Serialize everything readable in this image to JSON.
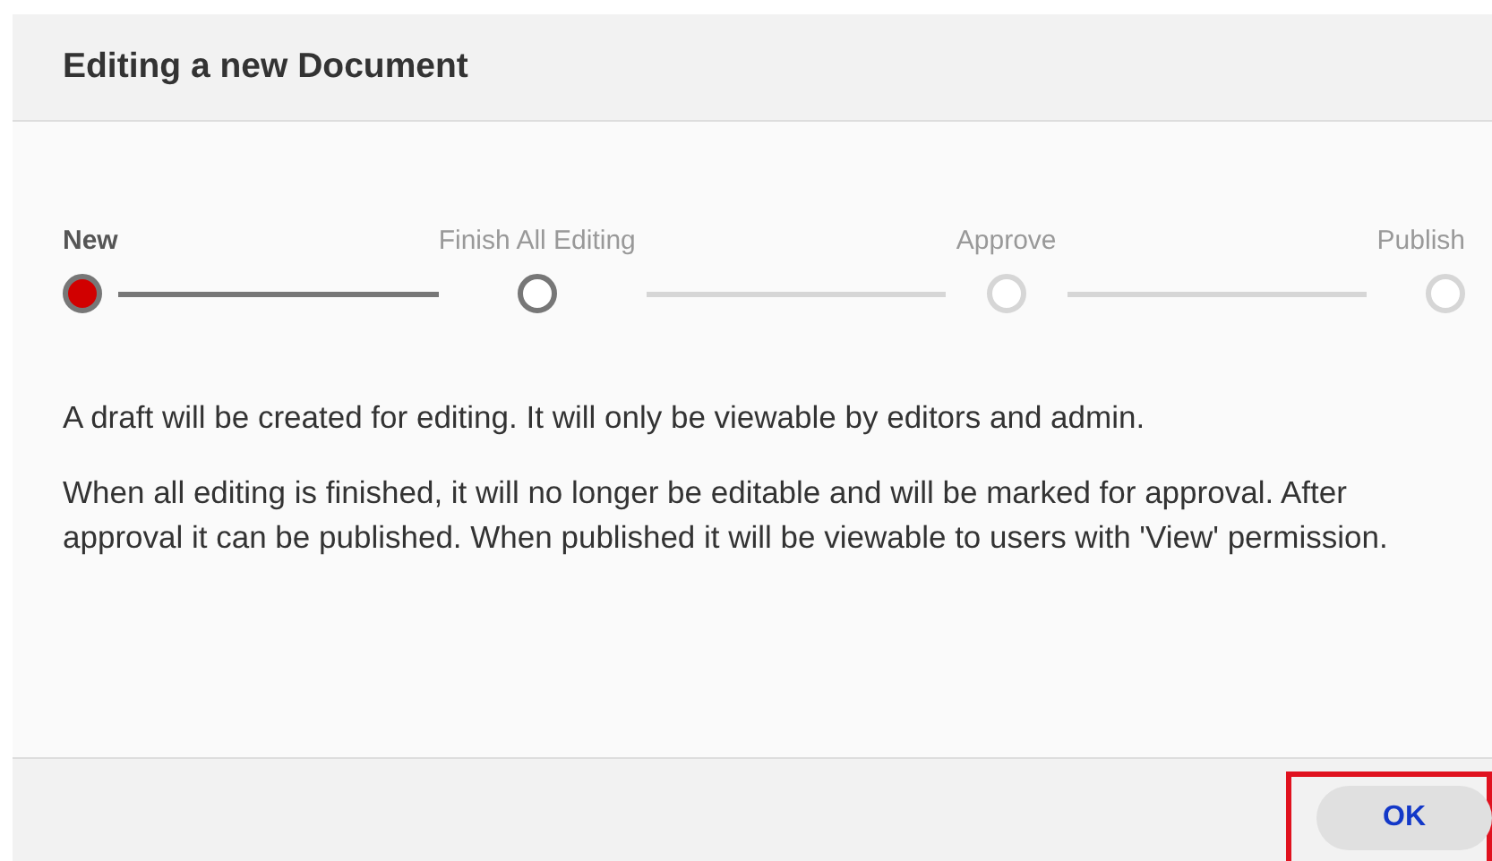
{
  "dialog": {
    "title": "Editing a new Document",
    "steps": [
      {
        "label": "New",
        "current": true,
        "reached": true
      },
      {
        "label": "Finish All Editing",
        "current": false,
        "reached": true
      },
      {
        "label": "Approve",
        "current": false,
        "reached": false
      },
      {
        "label": "Publish",
        "current": false,
        "reached": false
      }
    ],
    "paragraphs": [
      "A draft will be created for editing. It will only be viewable by editors and admin.",
      "When all editing is finished, it will no longer be editable and will be marked for approval. After approval it can be published. When published it will be viewable to users with 'View' permission."
    ],
    "buttons": [
      {
        "label": "OK",
        "highlighted": true
      }
    ]
  }
}
